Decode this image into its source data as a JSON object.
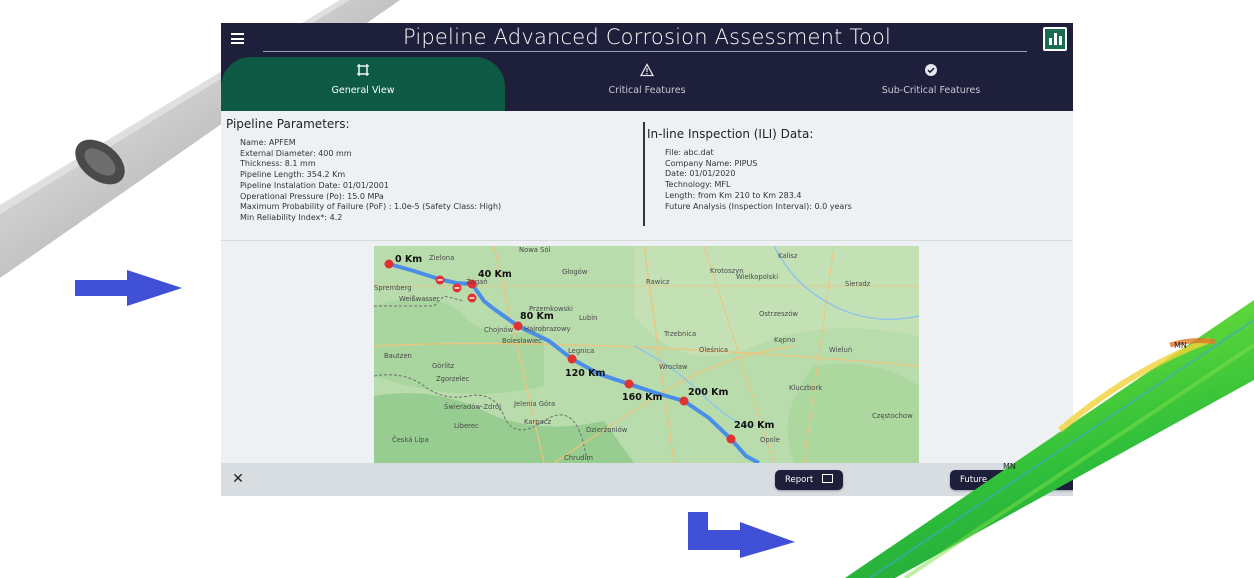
{
  "app": {
    "title": "Pipeline Advanced Corrosion Assessment Tool"
  },
  "tabs": [
    {
      "label": "General View",
      "icon": "grid-box-icon",
      "active": true
    },
    {
      "label": "Critical Features",
      "icon": "warning-triangle-icon",
      "active": false
    },
    {
      "label": "Sub-Critical Features",
      "icon": "check-circle-icon",
      "active": false
    }
  ],
  "pipeline": {
    "heading": "Pipeline Parameters:",
    "lines": [
      "Name: APFEM",
      "External Diameter: 400 mm",
      "Thickness: 8.1 mm",
      "Pipeline Length: 354.2 Km",
      "Pipeline Instalation Date: 01/01/2001",
      "Operational Pressure (Po): 15.0 MPa",
      "Maximum Probability of Failure (PoF) : 1.0e-5 (Safety Class: High)",
      "Min Reliability Index*: 4.2"
    ]
  },
  "ili": {
    "heading": "In-line Inspection (ILI) Data:",
    "lines": [
      "File: abc.dat",
      "Company Name: PIPUS",
      "Date: 01/01/2020",
      "Technology: MFL",
      "Length: from Km 210 to Km 283.4",
      "Future Analysis (Inspection Interval): 0.0 years"
    ]
  },
  "map": {
    "markers": [
      "0 Km",
      "40 Km",
      "80 Km",
      "120 Km",
      "160 Km",
      "200 Km",
      "240 Km"
    ],
    "cities": [
      "Nowa Sól",
      "Głogów",
      "Krotoszyn",
      "Wielkopolski",
      "Kalisz",
      "Zielona",
      "Żagań",
      "Rawicz",
      "Sieradz",
      "Spremberg",
      "Weißwasser",
      "Przemkowski",
      "Lubin",
      "Ostrzeszów",
      "Chojnów",
      "Trzebnica",
      "Oleśnica",
      "Kępno",
      "Wieluń",
      "Bolesławiec",
      "Legnica",
      "Wrocław",
      "Bautzen",
      "Görlitz",
      "Kluczbork",
      "Jelenia Góra",
      "Karpacz",
      "Dzierżoniów",
      "Opole",
      "Częstochow",
      "Česká Lípa",
      "Liberec",
      "Chrudim",
      "Świeradów-Zdrój",
      "Zgorzelec",
      "Hajrobrazowy"
    ],
    "colors": {
      "land": "#b9dcad",
      "route": "#4a8ee8",
      "marker": "#e03232",
      "border": "#6f6f6f",
      "road": "#f1c27a"
    }
  },
  "bottom": {
    "report_label": "Report",
    "future_label": "Future"
  },
  "pipes": {
    "left_label": "",
    "right_labels": [
      "MN",
      "MN"
    ]
  },
  "colors": {
    "navy": "#1e1f3b",
    "teal_active": "#0e5a45",
    "panel_bg": "#eef1f3",
    "arrow_blue": "#3f4fd6"
  }
}
